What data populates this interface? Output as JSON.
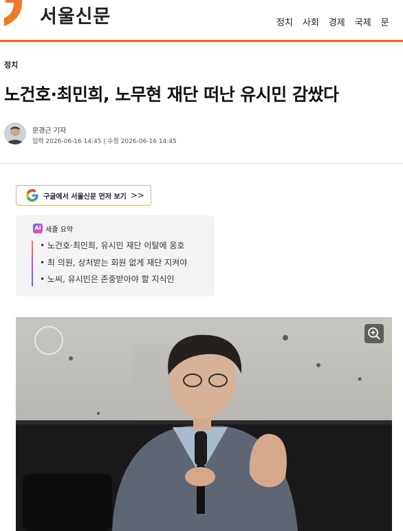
{
  "site": {
    "name": "서울신문",
    "nav": [
      "정치",
      "사회",
      "경제",
      "국제",
      "문"
    ],
    "accent": "#e8692a"
  },
  "article": {
    "section": "정치",
    "headline": "노건호·최민희, 노무현 재단 떠난 유시민 감쌌다",
    "reporter": "문경근 기자",
    "dates": "입력 2026-06-16 14:45 | 수정 2026-06-16 14:45"
  },
  "google": {
    "label": "구글에서 서울신문 먼저 보기",
    "chevron": ">>"
  },
  "summary": {
    "badge": "AI",
    "title": "세줄 요약",
    "items": [
      "• 노건호·최민희, 유시민 재단 이탈에 옹호",
      "• 최 의원, 상처받는 회원 없게 재단 지켜야",
      "• 노씨, 유시민은 존중받아야 할 지식인"
    ]
  },
  "photo": {
    "zoom_icon": "zoom-in-icon"
  }
}
